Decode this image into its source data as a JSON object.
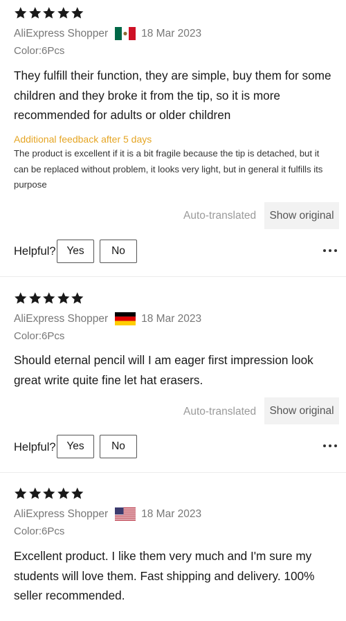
{
  "reviews": [
    {
      "rating": 5,
      "author": "AliExpress Shopper",
      "flag": "mexico-flag-icon",
      "date": "18 Mar 2023",
      "color": "Color:6Pcs",
      "text": "They fulfill their function, they are simple, buy them for some children and they broke it from the tip, so it is more recommended for adults or older children",
      "additional_title": "Additional feedback after 5 days",
      "additional_text": "The product is excellent if it is a bit fragile because the tip is detached, but it can be replaced without problem, it looks very light, but in general it fulfills its purpose",
      "auto_translated": "Auto-translated",
      "show_original": "Show original",
      "helpful": "Helpful?",
      "yes": "Yes",
      "no": "No"
    },
    {
      "rating": 5,
      "author": "AliExpress Shopper",
      "flag": "germany-flag-icon",
      "date": "18 Mar 2023",
      "color": "Color:6Pcs",
      "text": "Should eternal pencil will I am eager first impression look great write quite fine let hat erasers.",
      "auto_translated": "Auto-translated",
      "show_original": "Show original",
      "helpful": "Helpful?",
      "yes": "Yes",
      "no": "No"
    },
    {
      "rating": 5,
      "author": "AliExpress Shopper",
      "flag": "usa-flag-icon",
      "date": "18 Mar 2023",
      "color": "Color:6Pcs",
      "text": "Excellent product. I like them very much and I'm sure my students will love them. Fast shipping and delivery. 100% seller recommended."
    }
  ],
  "colors": {
    "star": "#191919",
    "meta_text": "#777777",
    "additional_feedback": "#e5a524",
    "divider": "#ececec"
  }
}
